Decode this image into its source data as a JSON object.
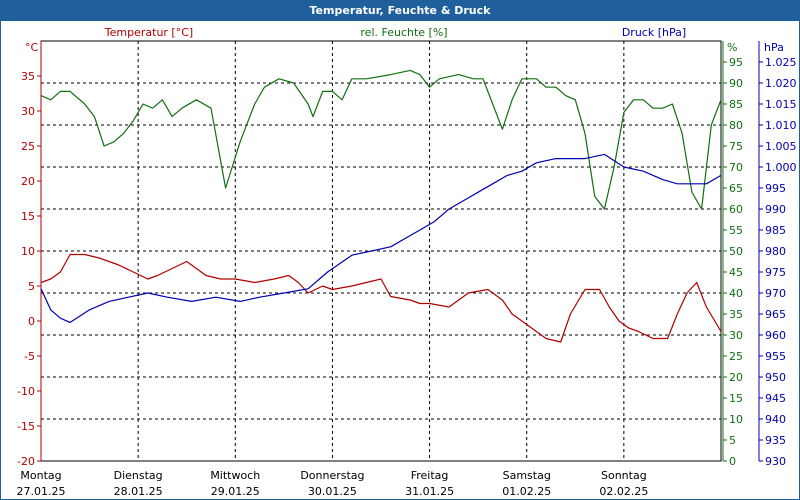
{
  "title": "Temperatur, Feuchte & Druck",
  "colors": {
    "temperature": "#b00000",
    "humidity": "#107010",
    "pressure": "#0000b0",
    "titlebar": "#1f5f9c",
    "grid": "#000000"
  },
  "chart_data": {
    "type": "line",
    "title": "Temperatur, Feuchte & Druck",
    "grid": true,
    "x_labels": [
      {
        "day": "Montag",
        "date": "27.01.25"
      },
      {
        "day": "Dienstag",
        "date": "28.01.25"
      },
      {
        "day": "Mittwoch",
        "date": "29.01.25"
      },
      {
        "day": "Donnerstag",
        "date": "30.01.25"
      },
      {
        "day": "Freitag",
        "date": "31.01.25"
      },
      {
        "day": "Samstag",
        "date": "01.02.25"
      },
      {
        "day": "Sonntag",
        "date": "02.02.25"
      }
    ],
    "x_range_days": [
      0,
      7
    ],
    "axes": {
      "temperature": {
        "label": "Temperatur [°C]",
        "unit": "°C",
        "min": -20,
        "max": 40,
        "step": 5,
        "ticks": [
          "-20",
          "-15",
          "-10",
          "-5",
          "0",
          "5",
          "10",
          "15",
          "20",
          "25",
          "30",
          "35"
        ]
      },
      "humidity": {
        "label": "rel. Feuchte [%]",
        "unit": "%",
        "min": 0,
        "max": 100,
        "step": 5,
        "ticks": [
          "0",
          "5",
          "10",
          "15",
          "20",
          "25",
          "30",
          "35",
          "40",
          "45",
          "50",
          "55",
          "60",
          "65",
          "70",
          "75",
          "80",
          "85",
          "90",
          "95"
        ]
      },
      "pressure": {
        "label": "Druck [hPa]",
        "unit": "hPa",
        "min": 930,
        "max": 1030,
        "step": 5,
        "ticks": [
          "930",
          "935",
          "940",
          "945",
          "950",
          "955",
          "960",
          "965",
          "970",
          "975",
          "980",
          "985",
          "990",
          "995",
          "1.000",
          "1.005",
          "1.010",
          "1.015",
          "1.020",
          "1.025"
        ]
      }
    },
    "series": [
      {
        "name": "Temperatur [°C]",
        "axis": "temperature",
        "color": "#b00000",
        "x": [
          0,
          0.1,
          0.2,
          0.3,
          0.45,
          0.6,
          0.8,
          0.95,
          1.1,
          1.2,
          1.35,
          1.5,
          1.6,
          1.7,
          1.85,
          2.0,
          2.2,
          2.4,
          2.55,
          2.65,
          2.75,
          2.9,
          3.0,
          3.2,
          3.35,
          3.5,
          3.6,
          3.8,
          3.9,
          4.0,
          4.2,
          4.4,
          4.6,
          4.75,
          4.85,
          4.95,
          5.05,
          5.2,
          5.35,
          5.45,
          5.6,
          5.75,
          5.85,
          5.95,
          6.05,
          6.15,
          6.3,
          6.45,
          6.55,
          6.65,
          6.75,
          6.85,
          7.0
        ],
        "values": [
          5.5,
          6,
          7,
          9.5,
          9.5,
          9,
          8,
          7,
          6,
          6.5,
          7.5,
          8.5,
          7.5,
          6.5,
          6,
          6,
          5.5,
          6,
          6.5,
          5.5,
          4,
          5,
          4.5,
          5,
          5.5,
          6,
          3.5,
          3,
          2.5,
          2.5,
          2,
          4,
          4.5,
          3,
          1,
          0,
          -1,
          -2.5,
          -3,
          1,
          4.5,
          4.5,
          2,
          0,
          -1,
          -1.5,
          -2.5,
          -2.5,
          1,
          4,
          5.5,
          2,
          -1.5
        ]
      },
      {
        "name": "rel. Feuchte [%]",
        "axis": "humidity",
        "color": "#107010",
        "x": [
          0,
          0.1,
          0.2,
          0.3,
          0.45,
          0.55,
          0.65,
          0.75,
          0.85,
          0.95,
          1.05,
          1.15,
          1.25,
          1.35,
          1.45,
          1.6,
          1.75,
          1.9,
          2.05,
          2.2,
          2.3,
          2.45,
          2.6,
          2.75,
          2.8,
          2.9,
          3.0,
          3.1,
          3.2,
          3.35,
          3.6,
          3.8,
          3.9,
          4.0,
          4.1,
          4.3,
          4.45,
          4.55,
          4.65,
          4.75,
          4.85,
          4.95,
          5.1,
          5.2,
          5.3,
          5.4,
          5.5,
          5.6,
          5.7,
          5.8,
          5.9,
          6.0,
          6.1,
          6.2,
          6.3,
          6.4,
          6.5,
          6.6,
          6.7,
          6.8,
          6.9,
          7.0
        ],
        "values": [
          87,
          86,
          88,
          88,
          85,
          82,
          75,
          76,
          78,
          81,
          85,
          84,
          86,
          82,
          84,
          86,
          84,
          65,
          76,
          85,
          89,
          91,
          90,
          85,
          82,
          88,
          88,
          86,
          91,
          91,
          92,
          93,
          92,
          89,
          91,
          92,
          91,
          91,
          85,
          79,
          86,
          91,
          91,
          89,
          89,
          87,
          86,
          78,
          63,
          60,
          70,
          83,
          86,
          86,
          84,
          84,
          85,
          78,
          64,
          60,
          80,
          86
        ]
      },
      {
        "name": "Druck [hPa]",
        "axis": "pressure",
        "color": "#0000b0",
        "x": [
          0,
          0.1,
          0.2,
          0.3,
          0.5,
          0.7,
          0.9,
          1.1,
          1.3,
          1.55,
          1.8,
          2.05,
          2.25,
          2.5,
          2.75,
          2.95,
          3.2,
          3.4,
          3.6,
          3.75,
          3.9,
          4.05,
          4.2,
          4.35,
          4.5,
          4.65,
          4.8,
          4.95,
          5.1,
          5.3,
          5.45,
          5.6,
          5.8,
          6.0,
          6.2,
          6.4,
          6.55,
          6.7,
          6.85,
          7.0
        ],
        "values": [
          971,
          966,
          964,
          963,
          966,
          968,
          969,
          970,
          969,
          968,
          969,
          968,
          969,
          970,
          971,
          975,
          979,
          980,
          981,
          983,
          985,
          987,
          990,
          992,
          994,
          996,
          998,
          999,
          1001,
          1002,
          1002,
          1002,
          1003,
          1000,
          999,
          997,
          996,
          996,
          996,
          998
        ]
      }
    ]
  }
}
